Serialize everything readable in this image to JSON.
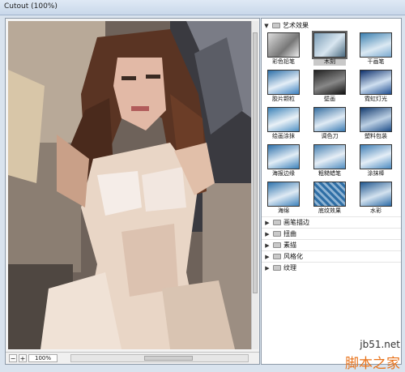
{
  "window": {
    "title": "Cutout (100%)"
  },
  "preview": {
    "zoom": "100%",
    "zoom_out": "−",
    "zoom_in": "+"
  },
  "filters": {
    "open_folder": "艺术效果",
    "items": [
      {
        "label": "彩色铅笔",
        "selected": false
      },
      {
        "label": "木刻",
        "selected": true
      },
      {
        "label": "干画笔",
        "selected": false
      },
      {
        "label": "胶片颗粒",
        "selected": false
      },
      {
        "label": "壁画",
        "selected": false
      },
      {
        "label": "霓虹灯光",
        "selected": false
      },
      {
        "label": "绘画涂抹",
        "selected": false
      },
      {
        "label": "调色刀",
        "selected": false
      },
      {
        "label": "塑料包装",
        "selected": false
      },
      {
        "label": "海报边缘",
        "selected": false
      },
      {
        "label": "粗糙蜡笔",
        "selected": false
      },
      {
        "label": "涂抹棒",
        "selected": false
      },
      {
        "label": "海绵",
        "selected": false
      },
      {
        "label": "底纹效果",
        "selected": false
      },
      {
        "label": "水彩",
        "selected": false
      }
    ],
    "categories": [
      "画笔描边",
      "扭曲",
      "素描",
      "风格化",
      "纹理"
    ]
  },
  "watermark": {
    "site": "jb51.net",
    "name": "脚本之家"
  },
  "colors": {
    "accent": "#e8721a"
  }
}
